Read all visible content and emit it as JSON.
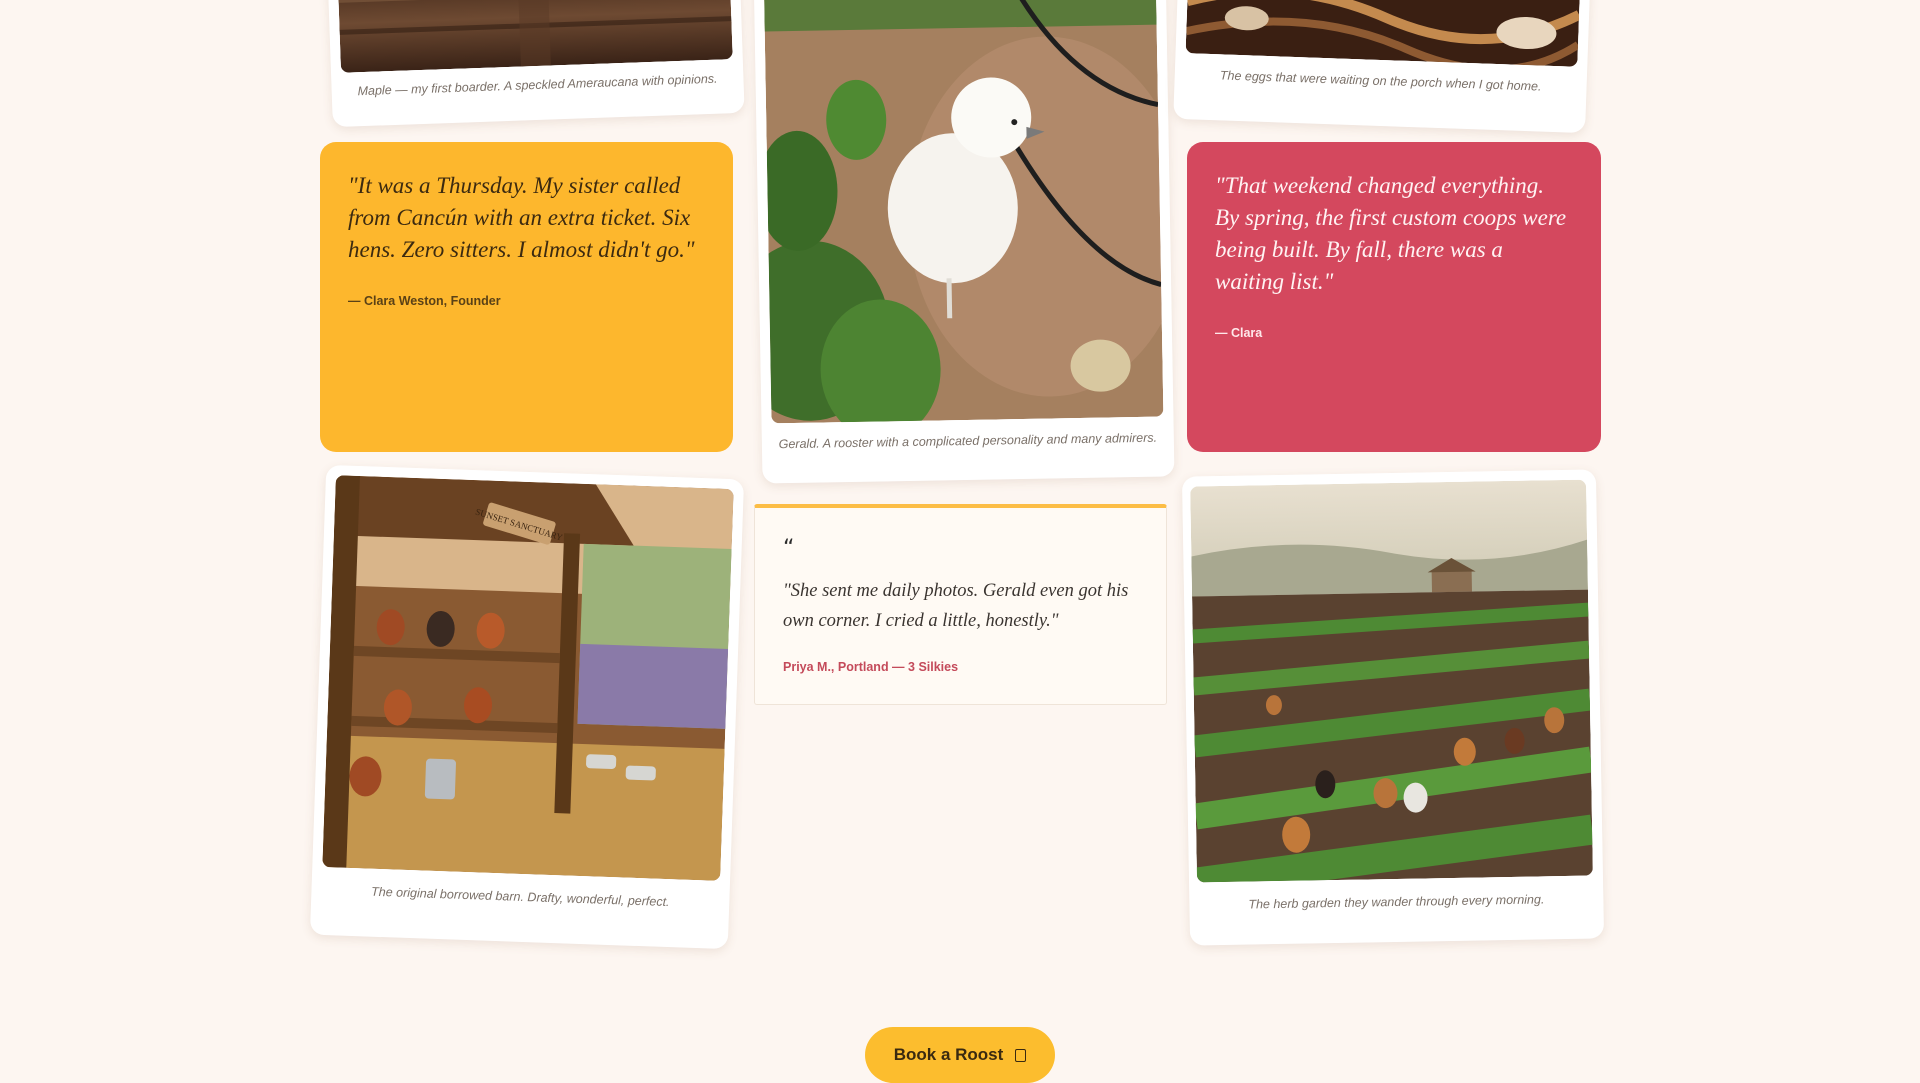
{
  "photo_cards": {
    "maple": {
      "caption": "Maple — my first boarder. A speckled Ameraucana with opinions.",
      "image": "wooden-perch-photo"
    },
    "gerald": {
      "caption": "Gerald. A rooster with a complicated personality and many admirers.",
      "image": "white-silkie-chick-in-garden-photo"
    },
    "eggs": {
      "caption": "The eggs that were waiting on the porch when I got home.",
      "image": "egg-basket-photo"
    },
    "barn": {
      "caption": "The original borrowed barn. Drafty, wonderful, perfect.",
      "image": "chickens-in-wooden-coop-photo",
      "sign_text": "SUNSET SANCTUARY"
    },
    "garden": {
      "caption": "The herb garden they wander through every morning.",
      "image": "chickens-in-garden-rows-photo"
    }
  },
  "quotes": {
    "founder": {
      "text": "\"It was a Thursday. My sister called from Cancún with an extra ticket. Six hens. Zero sitters. I almost didn't go.\"",
      "attribution": "— Clara Weston, Founder",
      "bg": "#fdb72d"
    },
    "weekend": {
      "text": "\"That weekend changed everything. By spring, the first custom coops were being built. By fall, there was a waiting list.\"",
      "attribution": "— Clara",
      "bg": "#d4485e"
    }
  },
  "testimonial": {
    "icon": "quote-icon",
    "text": "\"She sent me daily photos. Gerald even got his own corner. I cried a little, honestly.\"",
    "attribution": "Priya M., Portland — 3 Silkies",
    "accent": "#fcbd45"
  },
  "cta": {
    "label": "Book a Roost",
    "icon": "calendar-icon",
    "color": "#fcbd2e"
  }
}
